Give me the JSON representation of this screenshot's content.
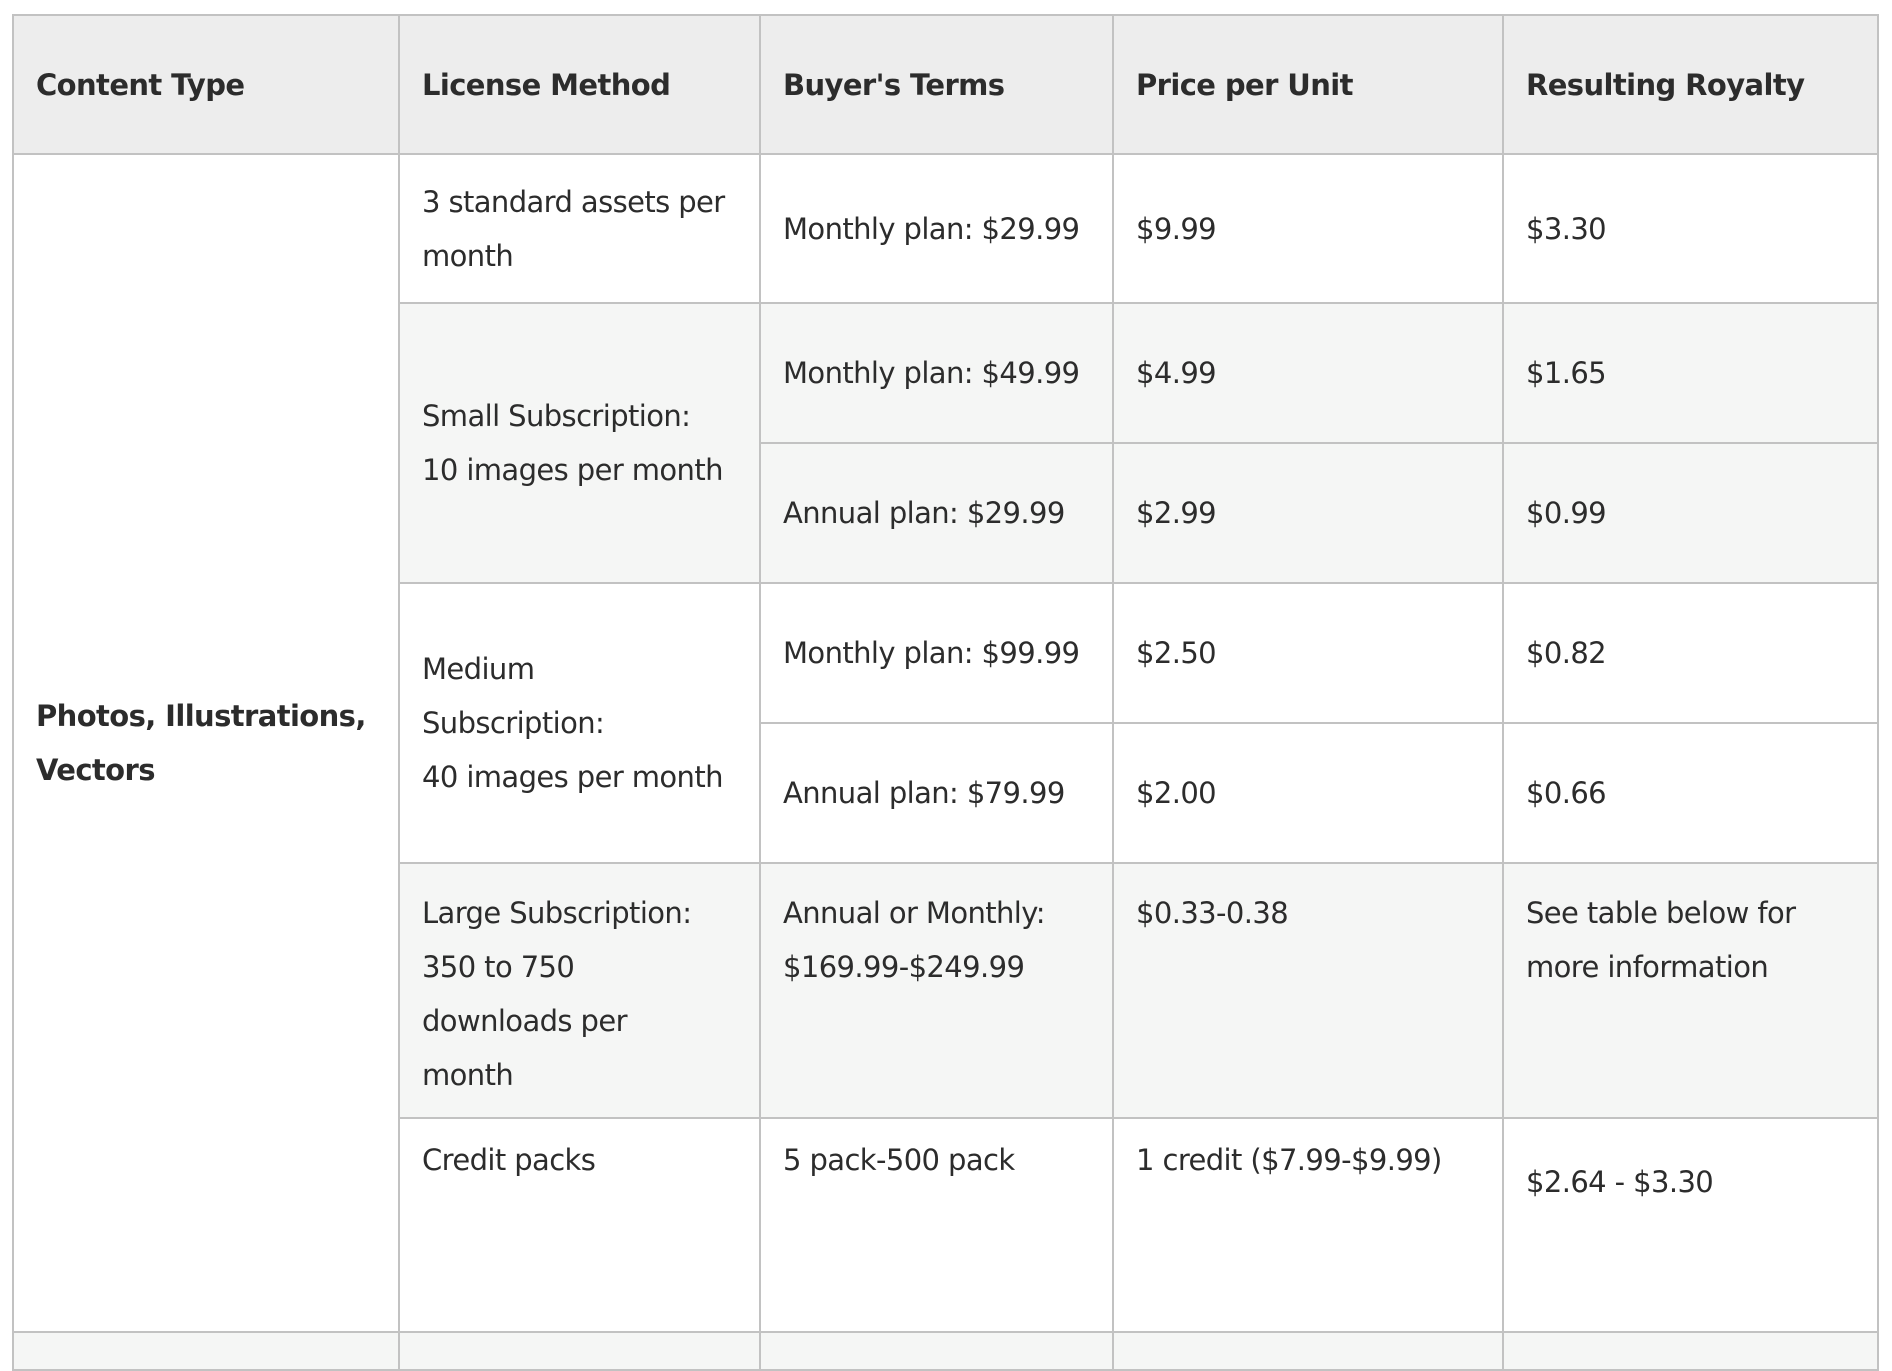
{
  "table": {
    "headers": [
      "Content Type",
      "License Method",
      "Buyer's Terms",
      "Price per Unit",
      "Resulting Royalty"
    ],
    "content_type": [
      "Photos, Illustrations,",
      "Vectors"
    ],
    "rows": [
      {
        "license_method": [
          "3 standard assets per",
          "month"
        ],
        "terms": [
          {
            "buyers_terms": [
              "Monthly plan: $29.99"
            ],
            "price_per_unit": [
              "$9.99"
            ],
            "royalty": [
              "$3.30"
            ]
          }
        ]
      },
      {
        "license_method": [
          "Small Subscription:",
          "10 images per month"
        ],
        "terms": [
          {
            "buyers_terms": [
              "Monthly plan: $49.99"
            ],
            "price_per_unit": [
              "$4.99"
            ],
            "royalty": [
              "$1.65"
            ]
          },
          {
            "buyers_terms": [
              "Annual plan: $29.99"
            ],
            "price_per_unit": [
              "$2.99"
            ],
            "royalty": [
              "$0.99"
            ]
          }
        ]
      },
      {
        "license_method": [
          "Medium",
          "Subscription:",
          "40 images per month"
        ],
        "terms": [
          {
            "buyers_terms": [
              "Monthly plan: $99.99"
            ],
            "price_per_unit": [
              "$2.50"
            ],
            "royalty": [
              "$0.82"
            ]
          },
          {
            "buyers_terms": [
              "Annual plan: $79.99"
            ],
            "price_per_unit": [
              "$2.00"
            ],
            "royalty": [
              "$0.66"
            ]
          }
        ]
      },
      {
        "license_method": [
          "Large Subscription:",
          "350 to 750",
          "downloads per",
          "month"
        ],
        "terms": [
          {
            "buyers_terms": [
              "Annual or Monthly:",
              "$169.99-$249.99"
            ],
            "price_per_unit": [
              "$0.33-0.38"
            ],
            "royalty": [
              "See table below for",
              "more information"
            ]
          }
        ]
      },
      {
        "license_method": [
          "Credit packs"
        ],
        "terms": [
          {
            "buyers_terms": [
              "5 pack-500 pack"
            ],
            "price_per_unit": [
              "1 credit ($7.99-$9.99)"
            ],
            "royalty": [
              "$2.64 - $3.30"
            ]
          }
        ]
      }
    ]
  }
}
